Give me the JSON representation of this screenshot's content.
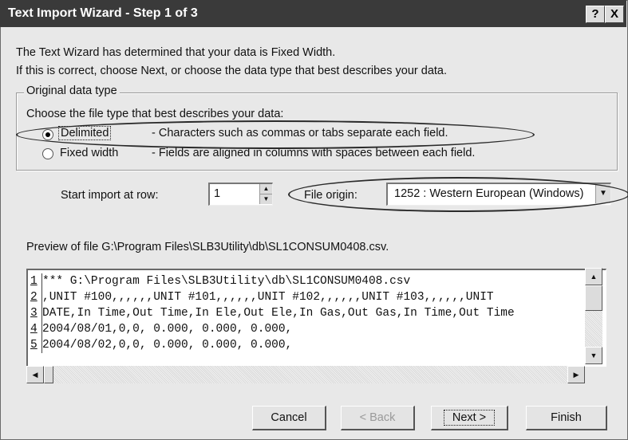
{
  "window": {
    "title": "Text Import Wizard - Step 1 of 3",
    "help_label": "?",
    "close_label": "X"
  },
  "intro": {
    "line1": "The Text Wizard has determined that your data is Fixed Width.",
    "line2": "If this is correct, choose Next, or choose the data type that best describes your data."
  },
  "original_data_type": {
    "group_label": "Original data type",
    "prompt": "Choose the file type that best describes your data:",
    "options": [
      {
        "label": "Delimited",
        "description": "- Characters such as commas or tabs separate each field.",
        "selected": true
      },
      {
        "label": "Fixed width",
        "description": "- Fields are aligned in columns with spaces between each field.",
        "selected": false
      }
    ]
  },
  "import": {
    "start_row_label": "Start import at row:",
    "start_row_value": "1",
    "file_origin_label": "File origin:",
    "file_origin_value": "1252 : Western European (Windows)"
  },
  "preview": {
    "label": "Preview of file G:\\Program Files\\SLB3Utility\\db\\SL1CONSUM0408.csv.",
    "rows": [
      {
        "num": "1",
        "text": "*** G:\\Program Files\\SLB3Utility\\db\\SL1CONSUM0408.csv"
      },
      {
        "num": "2",
        "text": ",UNIT #100,,,,,,UNIT #101,,,,,,UNIT #102,,,,,,UNIT #103,,,,,,UNIT"
      },
      {
        "num": "3",
        "text": "DATE,In Time,Out Time,In Ele,Out Ele,In Gas,Out Gas,In Time,Out Time"
      },
      {
        "num": "4",
        "text": "2004/08/01,0,0,        0.000,        0.000,        0.000,"
      },
      {
        "num": "5",
        "text": "2004/08/02,0,0,        0.000,        0.000,        0.000,"
      }
    ]
  },
  "buttons": {
    "cancel": "Cancel",
    "back": "< Back",
    "next": "Next >",
    "finish": "Finish"
  }
}
